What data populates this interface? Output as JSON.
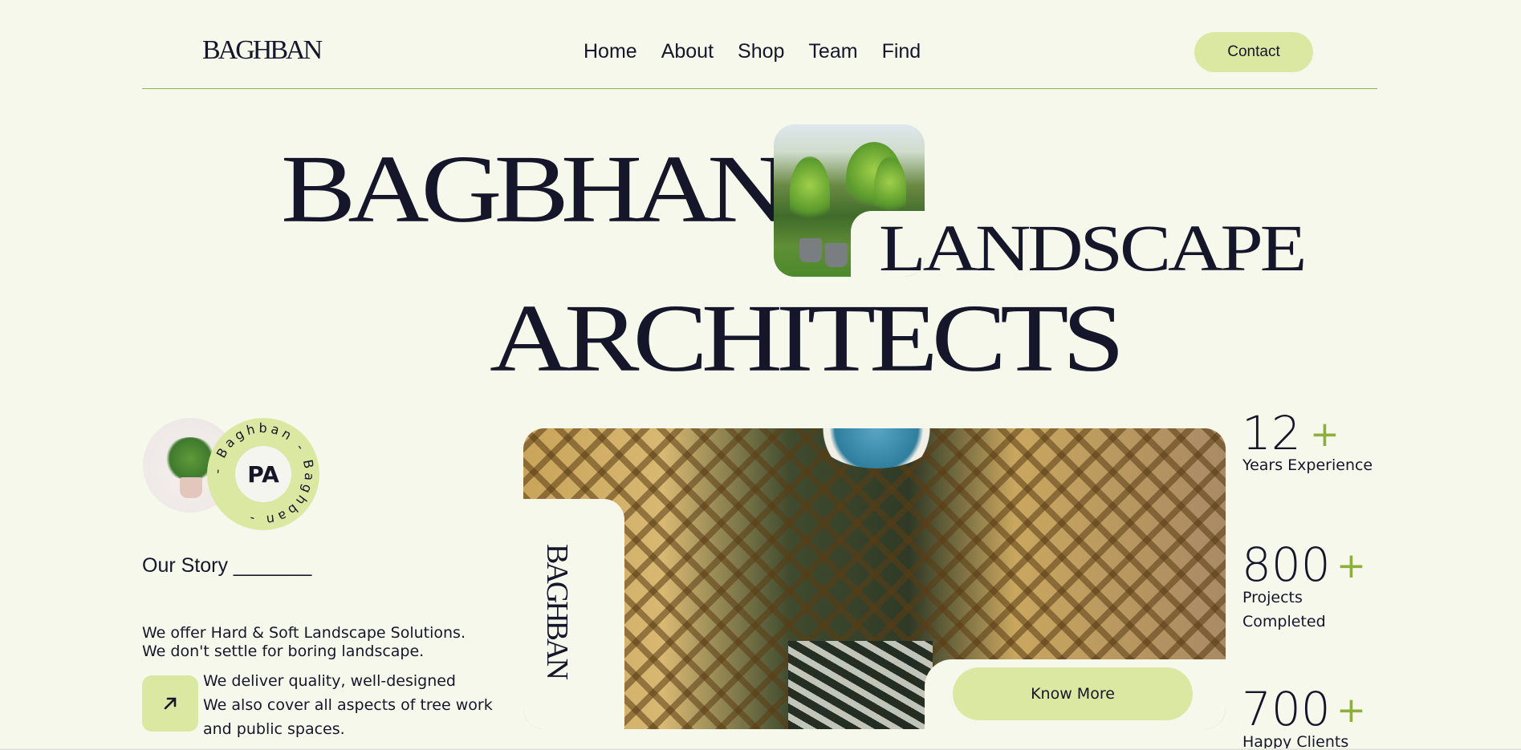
{
  "header": {
    "logo": "BAGHBAN",
    "nav": [
      "Home",
      "About",
      "Shop",
      "Team",
      "Find"
    ],
    "contact_label": "Contact"
  },
  "hero": {
    "word1": "BAGBHAN",
    "word2": "LANDSCAPE",
    "word3": "ARCHITECTS"
  },
  "badge": {
    "ring_text": "- Baghban - Baghban - ",
    "monogram": "PA"
  },
  "story": {
    "title": "Our Story _______",
    "line1": "We offer Hard & Soft Landscape Solutions.",
    "line2": "We don't settle for boring landscape.",
    "line3": "We deliver quality, well-designed",
    "line4": " We also cover all aspects of tree work",
    "line5": "and public spaces."
  },
  "feature": {
    "vertical_logo": "BAGHBAN",
    "know_more_label": "Know More"
  },
  "stats": [
    {
      "value": "12",
      "plus": "+",
      "label_lines": [
        "Years Experience"
      ]
    },
    {
      "value": "800",
      "plus": "+",
      "label_lines": [
        "Projects",
        "Completed"
      ]
    },
    {
      "value": "700",
      "plus": "+",
      "label_lines": [
        "Happy Clients"
      ]
    }
  ],
  "colors": {
    "background": "#f6f8ec",
    "accent": "#dbe8a2",
    "text": "#16162a",
    "plus": "#8faf3c"
  }
}
